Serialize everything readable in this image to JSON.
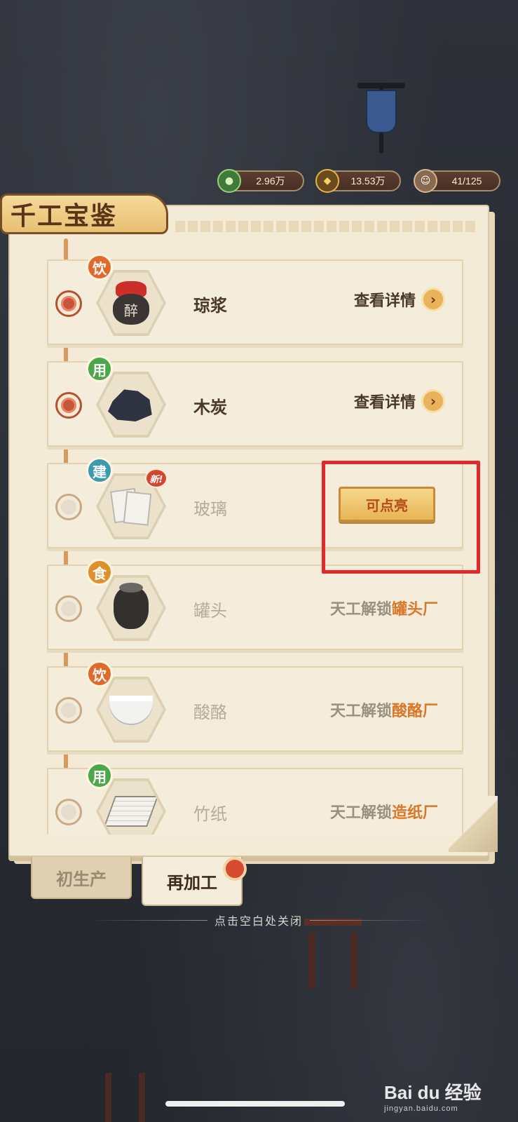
{
  "resources": {
    "jade": {
      "value": "2.96万",
      "icon": "jade-icon"
    },
    "coin": {
      "value": "13.53万",
      "icon": "coin-icon"
    },
    "people": {
      "value": "41/125",
      "icon": "people-icon"
    }
  },
  "panel": {
    "title": "千工宝鉴"
  },
  "items": [
    {
      "category": "饮",
      "name": "琼浆",
      "icon": "wine-jar-icon",
      "icon_text": "醉",
      "state": "unlocked",
      "action_label": "查看详情"
    },
    {
      "category": "用",
      "name": "木炭",
      "icon": "charcoal-icon",
      "state": "unlocked",
      "action_label": "查看详情"
    },
    {
      "category": "建",
      "name": "玻璃",
      "icon": "glass-icon",
      "state": "lightable",
      "new_badge": "新!",
      "action_label": "可点亮"
    },
    {
      "category": "食",
      "name": "罐头",
      "icon": "jar-icon",
      "state": "locked",
      "unlock_prefix": "天工解锁",
      "unlock_target": "罐头厂"
    },
    {
      "category": "饮",
      "name": "酸酪",
      "icon": "yogurt-bowl-icon",
      "state": "locked",
      "unlock_prefix": "天工解锁",
      "unlock_target": "酸酪厂"
    },
    {
      "category": "用",
      "name": "竹纸",
      "icon": "paper-icon",
      "state": "locked",
      "unlock_prefix": "天工解锁",
      "unlock_target": "造纸厂"
    }
  ],
  "tabs": [
    {
      "label": "初生产",
      "selected": false
    },
    {
      "label": "再加工",
      "selected": true
    }
  ],
  "close_hint": "点击空白处关闭",
  "watermark": {
    "brand": "Bai du 经验",
    "url": "jingyan.baidu.com"
  },
  "colors": {
    "highlight": "#e3282c",
    "accent_orange": "#d8782b",
    "panel_bg": "#f3ead7"
  }
}
